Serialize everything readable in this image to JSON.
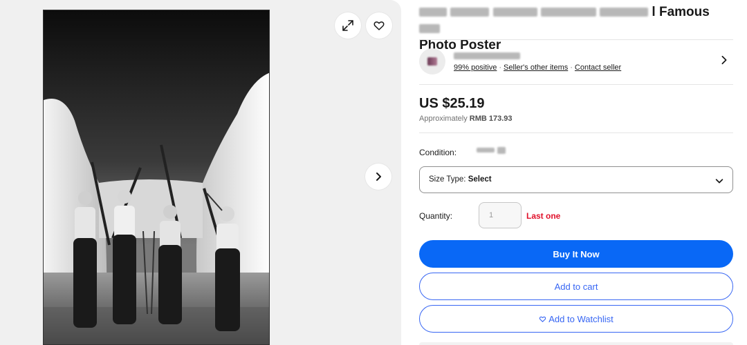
{
  "gallery": {
    "expand_icon": "expand-arrows-icon",
    "favorite_icon": "heart-outline-icon",
    "next_icon": "chevron-right-icon"
  },
  "listing": {
    "title_line1_visible": "l Famous",
    "title_line2": "Photo Poster"
  },
  "seller": {
    "feedback": "99% positive",
    "other_items": "Seller's other items",
    "contact": "Contact seller"
  },
  "price": {
    "main": "US $25.19",
    "approx_prefix": "Approximately",
    "approx_value": "RMB 173.93"
  },
  "condition": {
    "label": "Condition:"
  },
  "size_select": {
    "label": "Size Type:",
    "value": "Select"
  },
  "quantity": {
    "label": "Quantity:",
    "value": "1",
    "note": "Last one"
  },
  "buttons": {
    "buy_now": "Buy It Now",
    "add_to_cart": "Add to cart",
    "watchlist": "Add to Watchlist"
  },
  "colors": {
    "primary_blue": "#0968f6",
    "link_blue": "#3665f3",
    "alert_red": "#e0102a"
  }
}
